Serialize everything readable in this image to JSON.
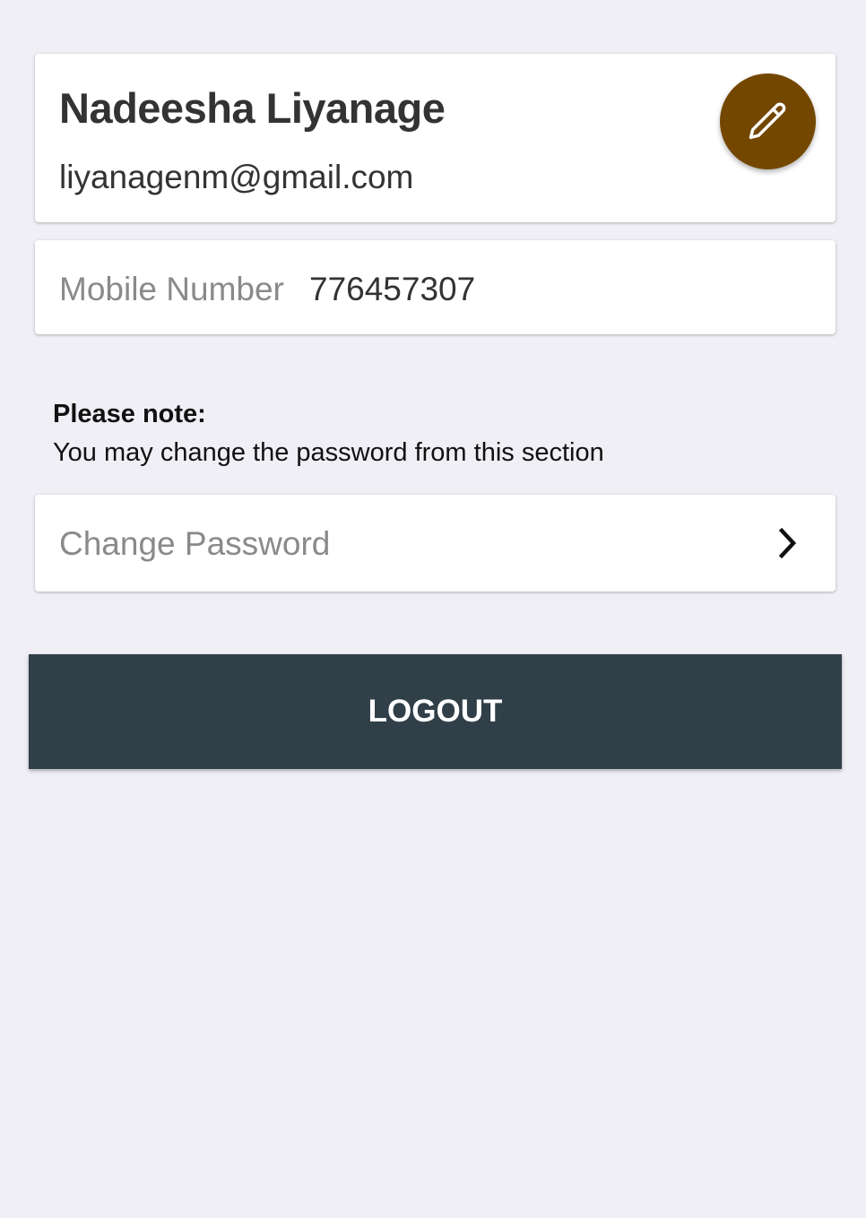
{
  "profile": {
    "name": "Nadeesha Liyanage",
    "email": "liyanagenm@gmail.com",
    "edit_icon": "pencil-icon"
  },
  "mobile": {
    "label": "Mobile Number",
    "value": "776457307"
  },
  "note": {
    "title": "Please note:",
    "text": "You may change the password from this section"
  },
  "change_password": {
    "label": "Change Password",
    "icon": "chevron-right-icon"
  },
  "logout": {
    "label": "LOGOUT"
  },
  "colors": {
    "background": "#efeff5",
    "fab": "#744700",
    "logout_button": "#303f48",
    "muted_text": "#8a8a8a",
    "primary_text": "#333333"
  }
}
